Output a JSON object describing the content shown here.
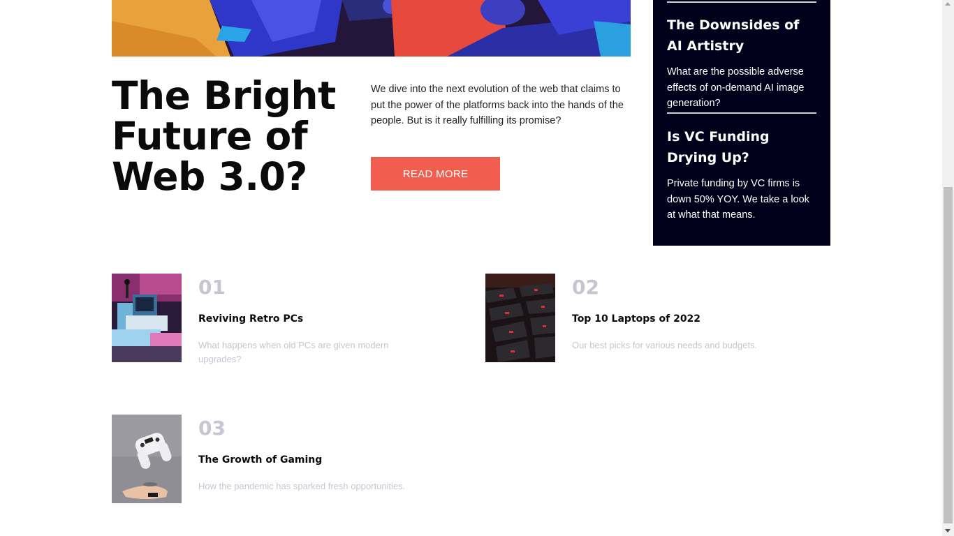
{
  "hero": {
    "title": "The Bright Future of Web 3.0?",
    "description": "We dive into the next evolution of the web that claims to put the power of the platforms back into the hands of the people. But is it really fulfilling its promise?",
    "button_label": "READ MORE"
  },
  "sidebar": {
    "items": [
      {
        "title": "The Downsides of AI Artistry",
        "description": "What are the possible adverse effects of on-demand AI image generation?"
      },
      {
        "title": "Is VC Funding Drying Up?",
        "description": "Private funding by VC firms is down 50% YOY. We take a look at what that means."
      }
    ]
  },
  "articles": [
    {
      "number": "01",
      "title": "Reviving Retro PCs",
      "description": "What happens when old PCs are given modern upgrades?"
    },
    {
      "number": "02",
      "title": "Top 10 Laptops of 2022",
      "description": "Our best picks for various needs and budgets."
    },
    {
      "number": "03",
      "title": "The Growth of Gaming",
      "description": "How the pandemic has sparked fresh opportunities."
    }
  ],
  "colors": {
    "accent": "#f15e50",
    "sidebar_bg": "#00001a",
    "muted_text": "#c5c6d0",
    "heading_text": "#0a0a0a"
  }
}
